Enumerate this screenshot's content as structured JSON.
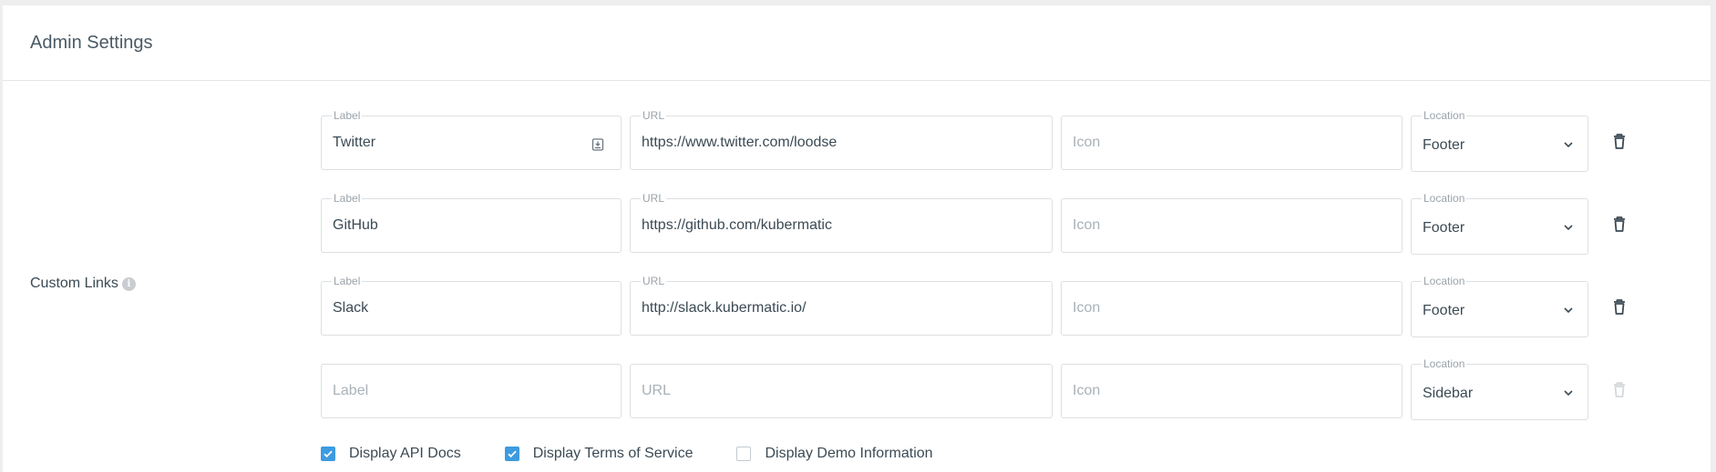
{
  "header": {
    "title": "Admin Settings"
  },
  "section": {
    "label": "Custom Links",
    "info_icon": "info-icon"
  },
  "field_labels": {
    "label": "Label",
    "url": "URL",
    "icon": "Icon",
    "location": "Location"
  },
  "links": [
    {
      "label": "Twitter",
      "url": "https://www.twitter.com/loodse",
      "icon": "",
      "location": "Footer"
    },
    {
      "label": "GitHub",
      "url": "https://github.com/kubermatic",
      "icon": "",
      "location": "Footer"
    },
    {
      "label": "Slack",
      "url": "http://slack.kubermatic.io/",
      "icon": "",
      "location": "Footer"
    }
  ],
  "new_link": {
    "label_placeholder": "Label",
    "url_placeholder": "URL",
    "icon_placeholder": "Icon",
    "location": "Sidebar"
  },
  "checkboxes": [
    {
      "label": "Display API Docs",
      "checked": true
    },
    {
      "label": "Display Terms of Service",
      "checked": true
    },
    {
      "label": "Display Demo Information",
      "checked": false
    }
  ],
  "colors": {
    "accent": "#3d9be0",
    "text": "#3b4a54",
    "border": "#dcdfe2"
  }
}
